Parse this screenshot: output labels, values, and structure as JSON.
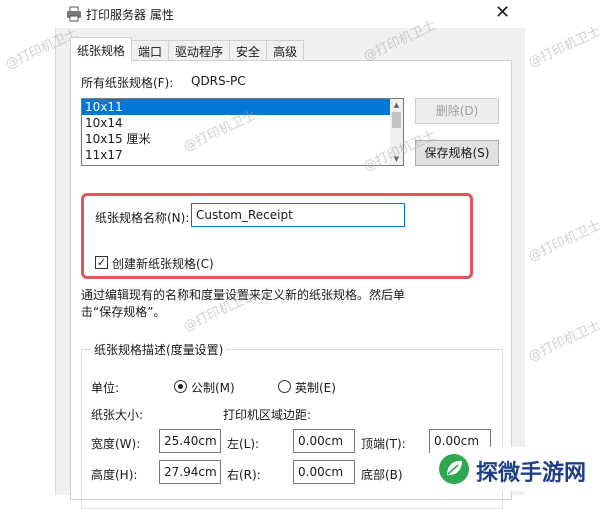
{
  "window": {
    "title": "打印服务器 属性"
  },
  "tabs": [
    "纸张规格",
    "端口",
    "驱动程序",
    "安全",
    "高级"
  ],
  "forms": {
    "all_forms_label": "所有纸张规格(F):",
    "server_name": "QDRS-PC",
    "list": [
      "10x11",
      "10x14",
      "10x15 厘米",
      "11x17"
    ],
    "delete_button": "删除(D)",
    "save_button": "保存规格(S)"
  },
  "form_name": {
    "label": "纸张规格名称(N):",
    "value": "Custom_Receipt",
    "create_checkbox": "创建新纸张规格(C)",
    "create_checked": true
  },
  "description": "通过编辑现有的名称和度量设置来定义新的纸张规格。然后单击“保存规格”。",
  "measurements": {
    "group_label": "纸张规格描述(度量设置)",
    "units_label": "单位:",
    "metric": "公制(M)",
    "english": "英制(E)",
    "metric_selected": true,
    "paper_size_label": "纸张大小:",
    "margins_label": "打印机区域边距:",
    "width_label": "宽度(W):",
    "width_value": "25.40cm",
    "height_label": "高度(H):",
    "height_value": "27.94cm",
    "left_label": "左(L):",
    "left_value": "0.00cm",
    "right_label": "右(R):",
    "right_value": "0.00cm",
    "top_label": "顶端(T):",
    "top_value": "0.00cm",
    "bottom_label": "底部(B)"
  },
  "watermark": "@打印机卫士",
  "brand": {
    "name": "探微手游网",
    "color": "#1f3e88",
    "icon_color": "#2fa84f"
  },
  "colors": {
    "selection": "#0078d7",
    "highlight_box": "#e0545a"
  }
}
